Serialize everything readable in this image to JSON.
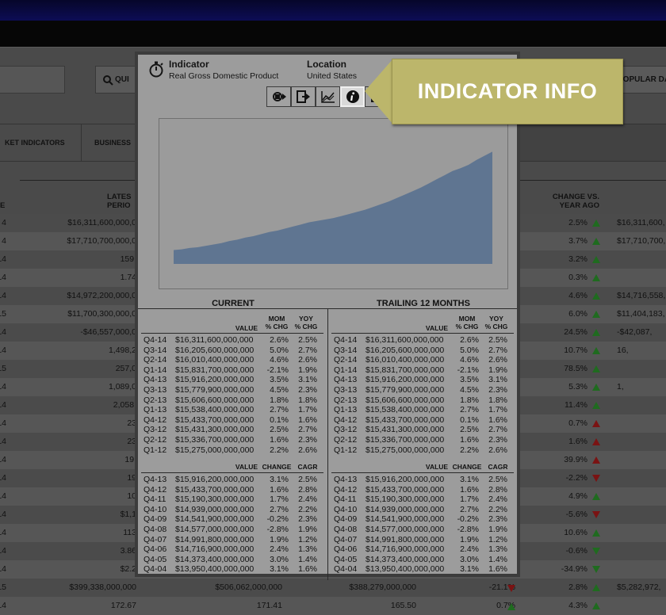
{
  "background": {
    "quick_label": "QUI",
    "popular_label": "POPULAR DA",
    "nav_tabs": [
      "KET INDICATORS",
      "BUSINESS"
    ],
    "col_headers": {
      "first": "E",
      "latest": "LATES\nPERIO",
      "change": "CHANGE VS.\nYEAR AGO"
    },
    "rows": [
      {
        "a": "4",
        "b": "$16,311,600,000,0",
        "c": "",
        "d": "",
        "e": "",
        "f": "2.5%",
        "fdir": "up-green",
        "g": "$16,311,600,"
      },
      {
        "a": "4",
        "b": "$17,710,700,000,0",
        "c": "",
        "d": "",
        "e": "",
        "f": "3.7%",
        "fdir": "up-green",
        "g": "$17,710,700,"
      },
      {
        "a": "14",
        "b": "159.",
        "c": "",
        "d": "",
        "e": "",
        "f": "3.2%",
        "fdir": "up-green",
        "g": ""
      },
      {
        "a": "14",
        "b": "1.74",
        "c": "",
        "d": "",
        "e": "",
        "f": "0.3%",
        "fdir": "up-green",
        "g": ""
      },
      {
        "a": "14",
        "b": "$14,972,200,000,0",
        "c": "",
        "d": "",
        "e": "",
        "f": "4.6%",
        "fdir": "up-green",
        "g": "$14,716,558,"
      },
      {
        "a": "15",
        "b": "$11,700,300,000,0",
        "c": "",
        "d": "",
        "e": "",
        "f": "6.0%",
        "fdir": "up-green",
        "g": "$11,404,183,"
      },
      {
        "a": "14",
        "b": "-$46,557,000,0",
        "c": "",
        "d": "",
        "e": "",
        "f": "24.5%",
        "fdir": "up-green",
        "g": "-$42,087,"
      },
      {
        "a": "14",
        "b": "1,498,2",
        "c": "",
        "d": "",
        "e": "",
        "f": "10.7%",
        "fdir": "up-green",
        "g": "16,"
      },
      {
        "a": "15",
        "b": "257,0",
        "c": "",
        "d": "",
        "e": "",
        "f": "78.5%",
        "fdir": "up-green",
        "g": ""
      },
      {
        "a": "14",
        "b": "1,089,0",
        "c": "",
        "d": "",
        "e": "",
        "f": "5.3%",
        "fdir": "up-green",
        "g": "1,"
      },
      {
        "a": "14",
        "b": "2,058.",
        "c": "",
        "d": "",
        "e": "",
        "f": "11.4%",
        "fdir": "up-green",
        "g": ""
      },
      {
        "a": "14",
        "b": "23",
        "c": "",
        "d": "",
        "e": "",
        "f": "0.7%",
        "fdir": "up-red",
        "g": ""
      },
      {
        "a": "14",
        "b": "23",
        "c": "",
        "d": "",
        "e": "",
        "f": "1.6%",
        "fdir": "up-red",
        "g": ""
      },
      {
        "a": "14",
        "b": "19.",
        "c": "",
        "d": "",
        "e": "",
        "f": "39.9%",
        "fdir": "up-red",
        "g": ""
      },
      {
        "a": "14",
        "b": "19",
        "c": "",
        "d": "",
        "e": "",
        "f": "-2.2%",
        "fdir": "down-red",
        "g": ""
      },
      {
        "a": "14",
        "b": "10",
        "c": "",
        "d": "",
        "e": "",
        "f": "4.9%",
        "fdir": "up-green",
        "g": ""
      },
      {
        "a": "14",
        "b": "$1,1",
        "c": "",
        "d": "",
        "e": "",
        "f": "-5.6%",
        "fdir": "down-red",
        "g": ""
      },
      {
        "a": "14",
        "b": "113",
        "c": "",
        "d": "",
        "e": "",
        "f": "10.6%",
        "fdir": "up-green",
        "g": ""
      },
      {
        "a": "14",
        "b": "3.86",
        "c": "",
        "d": "",
        "e": "",
        "f": "-0.6%",
        "fdir": "down-green",
        "g": ""
      },
      {
        "a": "14",
        "b": "$2.2",
        "c": "",
        "d": "",
        "e": "",
        "f": "-34.9%",
        "fdir": "down-green",
        "g": ""
      },
      {
        "a": "15",
        "b": "$399,338,000,000",
        "c": "$506,062,000,000",
        "d": "$388,279,000,000",
        "e": "-21.1%",
        "edir": "down-red",
        "f": "2.8%",
        "fdir": "up-green",
        "g": "$5,282,972,"
      },
      {
        "a": "14",
        "b": "172.67",
        "c": "171.41",
        "d": "165.50",
        "e": "0.7%",
        "edir": "up-green",
        "f": "4.3%",
        "fdir": "up-green",
        "g": ""
      }
    ]
  },
  "popup": {
    "indicator_label": "Indicator",
    "indicator_value": "Real Gross Domestic Product",
    "location_label": "Location",
    "location_value": "United States",
    "current_title": "CURRENT",
    "trailing_title": "TRAILING 12 MONTHS",
    "col_value": "VALUE",
    "col_mom": "MOM\n% CHG",
    "col_yoy": "YOY\n% CHG",
    "col_change": "CHANGE",
    "col_cagr": "CAGR",
    "quarterly": [
      [
        "Q4-14",
        "$16,311,600,000,000",
        "2.6%",
        "2.5%"
      ],
      [
        "Q3-14",
        "$16,205,600,000,000",
        "5.0%",
        "2.7%"
      ],
      [
        "Q2-14",
        "$16,010,400,000,000",
        "4.6%",
        "2.6%"
      ],
      [
        "Q1-14",
        "$15,831,700,000,000",
        "-2.1%",
        "1.9%"
      ],
      [
        "Q4-13",
        "$15,916,200,000,000",
        "3.5%",
        "3.1%"
      ],
      [
        "Q3-13",
        "$15,779,900,000,000",
        "4.5%",
        "2.3%"
      ],
      [
        "Q2-13",
        "$15,606,600,000,000",
        "1.8%",
        "1.8%"
      ],
      [
        "Q1-13",
        "$15,538,400,000,000",
        "2.7%",
        "1.7%"
      ],
      [
        "Q4-12",
        "$15,433,700,000,000",
        "0.1%",
        "1.6%"
      ],
      [
        "Q3-12",
        "$15,431,300,000,000",
        "2.5%",
        "2.7%"
      ],
      [
        "Q2-12",
        "$15,336,700,000,000",
        "1.6%",
        "2.3%"
      ],
      [
        "Q1-12",
        "$15,275,000,000,000",
        "2.2%",
        "2.6%"
      ]
    ],
    "history": [
      [
        "Q4-13",
        "$15,916,200,000,000",
        "3.1%",
        "2.5%"
      ],
      [
        "Q4-12",
        "$15,433,700,000,000",
        "1.6%",
        "2.8%"
      ],
      [
        "Q4-11",
        "$15,190,300,000,000",
        "1.7%",
        "2.4%"
      ],
      [
        "Q4-10",
        "$14,939,000,000,000",
        "2.7%",
        "2.2%"
      ],
      [
        "Q4-09",
        "$14,541,900,000,000",
        "-0.2%",
        "2.3%"
      ],
      [
        "Q4-08",
        "$14,577,000,000,000",
        "-2.8%",
        "1.9%"
      ],
      [
        "Q4-07",
        "$14,991,800,000,000",
        "1.9%",
        "1.2%"
      ],
      [
        "Q4-06",
        "$14,716,900,000,000",
        "2.4%",
        "1.3%"
      ],
      [
        "Q4-05",
        "$14,373,400,000,000",
        "3.0%",
        "1.4%"
      ],
      [
        "Q4-04",
        "$13,950,400,000,000",
        "3.1%",
        "1.6%"
      ]
    ]
  },
  "callout": {
    "text": "INDICATOR INFO",
    "color": "#bcb66b"
  },
  "chart_data": {
    "type": "area",
    "title": "",
    "xlabel": "",
    "ylabel": "",
    "color": "#5f7591",
    "x": [
      0,
      1,
      2,
      3,
      4,
      5,
      6,
      7,
      8,
      9,
      10,
      11,
      12,
      13,
      14,
      15,
      16,
      17,
      18,
      19,
      20,
      21,
      22,
      23,
      24,
      25,
      26,
      27,
      28,
      29,
      30,
      31,
      32,
      33,
      34,
      35,
      36,
      37,
      38,
      39,
      40
    ],
    "values": [
      20,
      21,
      23,
      24,
      26,
      28,
      30,
      33,
      35,
      38,
      40,
      43,
      46,
      48,
      51,
      54,
      57,
      60,
      62,
      64,
      66,
      69,
      72,
      75,
      78,
      82,
      86,
      90,
      95,
      100,
      105,
      110,
      116,
      122,
      128,
      134,
      138,
      143,
      150,
      156,
      162
    ],
    "ylim": [
      0,
      175
    ]
  }
}
